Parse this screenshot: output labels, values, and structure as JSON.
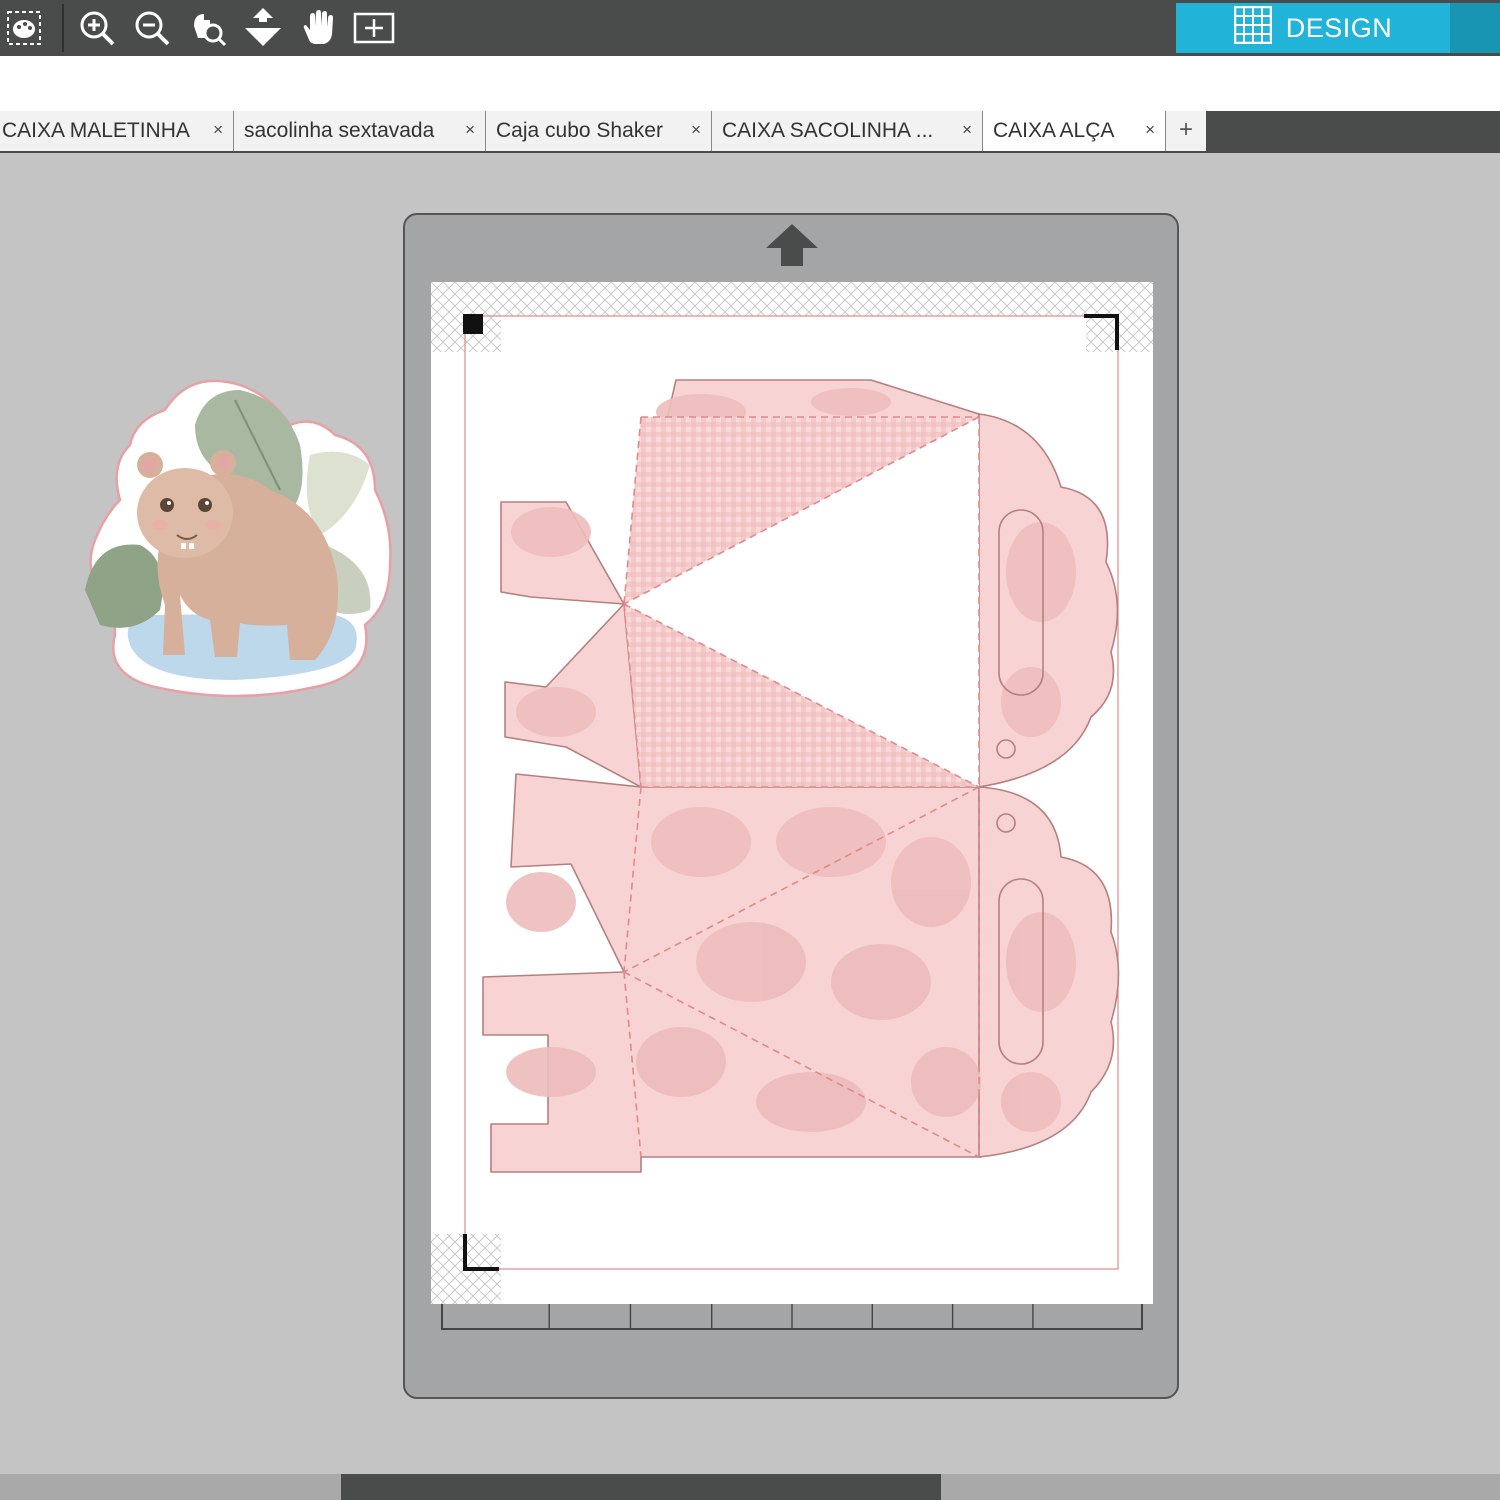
{
  "toolbar": {
    "tools": [
      {
        "name": "select-tool-icon"
      },
      {
        "name": "zoom-in-icon"
      },
      {
        "name": "zoom-out-icon"
      },
      {
        "name": "zoom-selection-icon"
      },
      {
        "name": "move-down-icon"
      },
      {
        "name": "pan-hand-icon"
      },
      {
        "name": "fit-to-page-icon"
      }
    ],
    "design_label": "DESIGN",
    "design_icon": "grid-icon"
  },
  "tabs": [
    {
      "label": "CAIXA MALETINHA",
      "close": "×"
    },
    {
      "label": "sacolinha sextavada",
      "close": "×"
    },
    {
      "label": "Caja cubo Shaker",
      "close": "×"
    },
    {
      "label": "CAIXA SACOLINHA ...",
      "close": "×"
    },
    {
      "label": "CAIXA ALÇA",
      "close": "×",
      "active": true
    }
  ],
  "add_tab": "+",
  "colors": {
    "toolbar_bg": "#4a4c4c",
    "design_accent": "#22b4d8",
    "canvas_bg": "#c4c4c4",
    "mat": "#a3a5a6",
    "template_pink": "#f4cfcf",
    "cut_line": "#e08a8a"
  }
}
